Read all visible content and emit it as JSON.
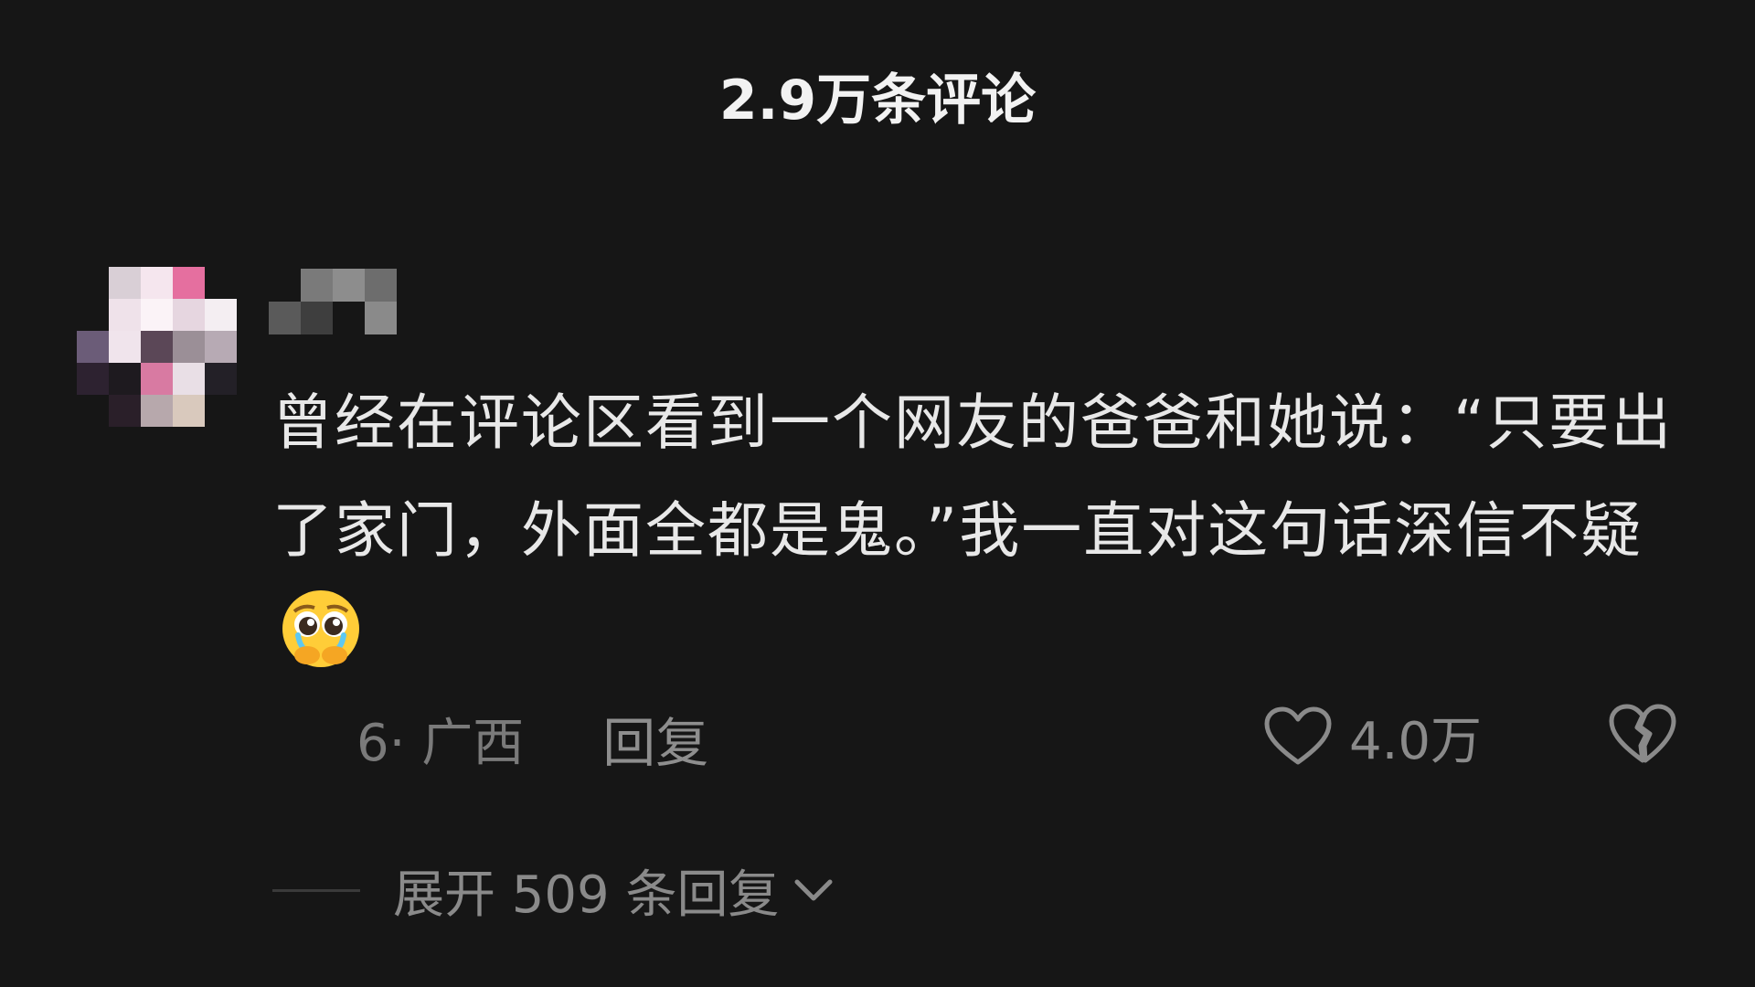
{
  "header": {
    "title": "2.9万条评论"
  },
  "comment": {
    "text": "曾经在评论区看到一个网友的爸爸和她说：“只要出了家门，外面全都是鬼。”我一直对这句话深信不疑",
    "emoji": "pleading-face-crying-icon",
    "meta": "6· 广西",
    "reply_label": "回复",
    "like_count": "4.0万",
    "expand_label": "展开 509 条回复"
  },
  "colors": {
    "background": "#161616",
    "title": "#f2f2f2",
    "text": "#e8e8e8",
    "muted": "#8a8a8a"
  },
  "avatar_pixels": [
    "#161616",
    "#d9cfd6",
    "#f5e6ee",
    "#e56f9f",
    "#161616",
    "#161616",
    "#efe2ea",
    "#fbf3f7",
    "#e6d6e0",
    "#f4eef2",
    "#6b5c78",
    "#f0e4ec",
    "#5b4757",
    "#9b8f97",
    "#b7aab4",
    "#2d2230",
    "#1e1a1f",
    "#d87aa2",
    "#e9dfe6",
    "#232027",
    "#161616",
    "#2a1f29",
    "#b7a8ac",
    "#d9c9bd",
    "#161616"
  ],
  "username_pixels": [
    "#161616",
    "#7a7a7a",
    "#8d8d8d",
    "#6d6d6d",
    "#5a5a5a",
    "#3e3e3e",
    "#161616",
    "#8a8a8a"
  ]
}
